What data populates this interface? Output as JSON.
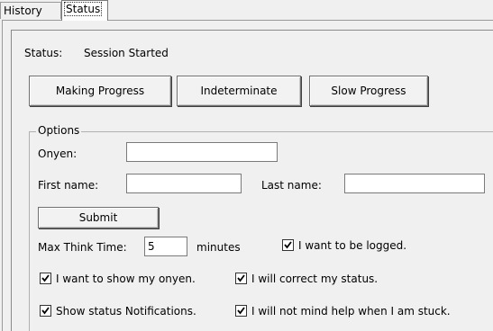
{
  "tabs": {
    "history": "History",
    "status": "Status"
  },
  "status": {
    "label": "Status:",
    "value": "Session Started"
  },
  "buttons": {
    "making_progress": "Making Progress",
    "indeterminate": "Indeterminate",
    "slow_progress": "Slow Progress",
    "submit": "Submit"
  },
  "options": {
    "title": "Options",
    "onyen_label": "Onyen:",
    "onyen_value": "",
    "first_name_label": "First name:",
    "first_name_value": "",
    "last_name_label": "Last name:",
    "last_name_value": "",
    "max_think_label": "Max Think Time:",
    "max_think_value": "5",
    "minutes_label": "minutes"
  },
  "checkboxes": [
    {
      "label": "I want to be logged.",
      "checked": true
    },
    {
      "label": "I want to show my onyen.",
      "checked": true
    },
    {
      "label": "I will correct my status.",
      "checked": true
    },
    {
      "label": "Show status Notifications.",
      "checked": true
    },
    {
      "label": "I will not mind help when I am stuck.",
      "checked": true
    }
  ],
  "icons": {
    "check": "checkmark-icon"
  }
}
